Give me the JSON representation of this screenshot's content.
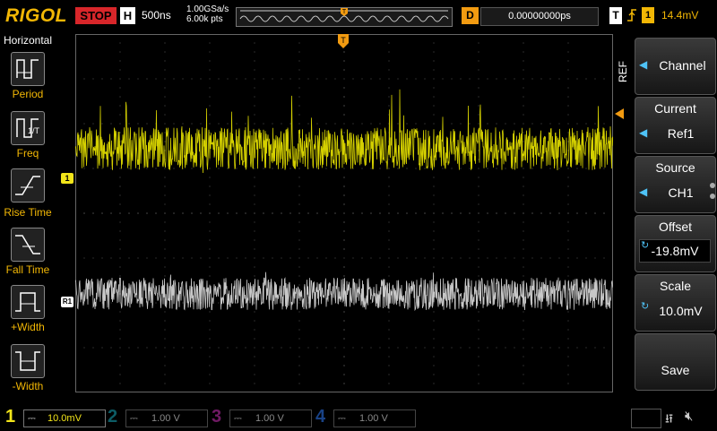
{
  "header": {
    "brand": "RIGOL",
    "run_state": "STOP",
    "timebase_label": "H",
    "timebase_value": "500ns",
    "sample_rate": "1.00GSa/s",
    "memory_depth": "6.00k pts",
    "trigger_position_marker": "T",
    "delay_label": "D",
    "delay_value": "0.00000000ps",
    "trigger_label": "T",
    "trigger_edge_icon": "rising-edge",
    "trigger_channel": "1",
    "trigger_level": "14.4mV"
  },
  "left_menu": {
    "title": "Horizontal",
    "items": [
      {
        "label": "Period"
      },
      {
        "label": "Freq"
      },
      {
        "label": "Rise Time"
      },
      {
        "label": "Fall Time"
      },
      {
        "label": "+Width"
      },
      {
        "label": "-Width"
      }
    ]
  },
  "screen": {
    "ch1_marker": "1",
    "ref_marker": "R1",
    "trigger_top_marker": "T"
  },
  "right_menu": {
    "section": "REF",
    "channel": {
      "label": "Channel"
    },
    "current": {
      "title": "Current",
      "value": "Ref1"
    },
    "source": {
      "title": "Source",
      "value": "CH1"
    },
    "offset": {
      "title": "Offset",
      "value": "-19.8mV"
    },
    "scale": {
      "title": "Scale",
      "value": "10.0mV"
    },
    "save": {
      "label": "Save"
    }
  },
  "channels": [
    {
      "num": "1",
      "scale": "10.0mV",
      "color": "#f2e51a"
    },
    {
      "num": "2",
      "scale": "1.00 V",
      "color": "#1bb7c9"
    },
    {
      "num": "3",
      "scale": "1.00 V",
      "color": "#e034c8"
    },
    {
      "num": "4",
      "scale": "1.00 V",
      "color": "#2a6fe0"
    }
  ],
  "colors": {
    "ch1_trace": "#d4d000",
    "ref_trace": "#c8c8c8",
    "accent": "#f29b11",
    "brand": "#f2b705"
  }
}
